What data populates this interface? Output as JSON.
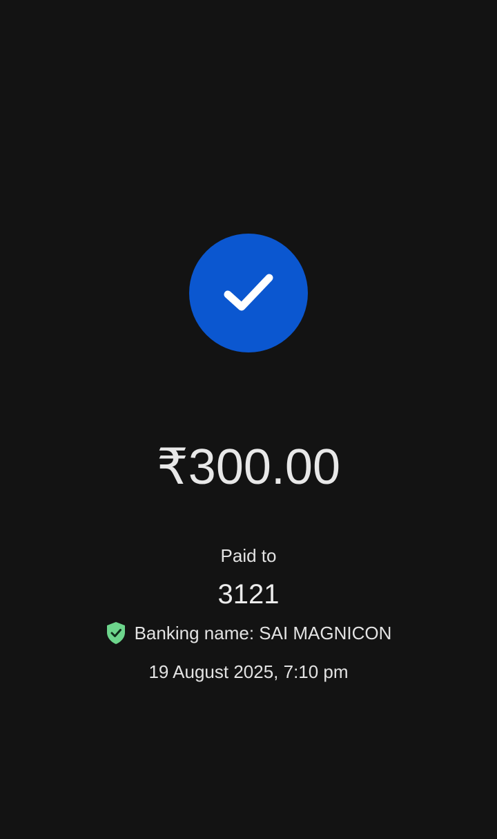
{
  "status": {
    "icon": "check-icon",
    "accent_color": "#0b57d0"
  },
  "payment": {
    "amount": "₹300.00",
    "paid_to_label": "Paid to",
    "payee": "3121",
    "banking_name": "Banking name: SAI MAGNICON",
    "verified_icon": "verified-shield-icon",
    "verified_color": "#6dd58c",
    "datetime": "19 August 2025, 7:10 pm"
  }
}
